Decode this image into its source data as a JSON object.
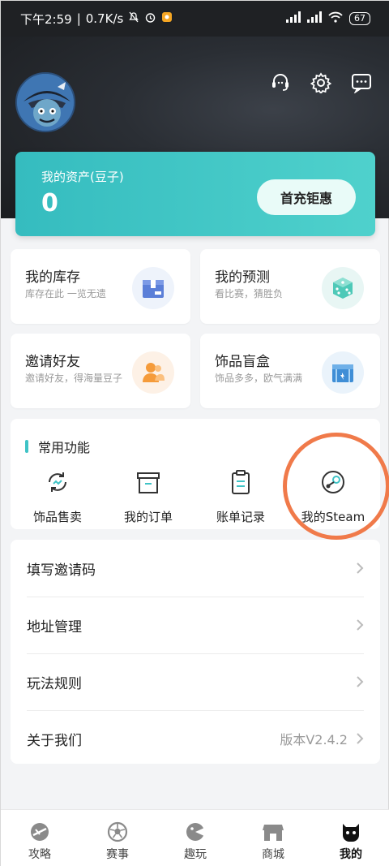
{
  "status_bar": {
    "time": "下午2:59",
    "network_speed": "0.7K/s",
    "battery": "67"
  },
  "header": {
    "icons": [
      "customer-service-icon",
      "gear-icon",
      "message-icon"
    ]
  },
  "asset": {
    "label": "我的资产(豆子)",
    "value": "0",
    "button_label": "首充钜惠"
  },
  "cards": [
    {
      "title": "我的库存",
      "subtitle": "库存在此 一览无遗",
      "icon": "inventory-box-icon"
    },
    {
      "title": "我的预测",
      "subtitle": "看比赛，猜胜负",
      "icon": "dice-icon"
    },
    {
      "title": "邀请好友",
      "subtitle": "邀请好友，得海量豆子",
      "icon": "invite-friends-icon"
    },
    {
      "title": "饰品盲盒",
      "subtitle": "饰品多多，欧气满满",
      "icon": "blind-box-icon"
    }
  ],
  "common": {
    "title": "常用功能",
    "items": [
      {
        "label": "饰品售卖",
        "icon": "trade-icon"
      },
      {
        "label": "我的订单",
        "icon": "order-icon"
      },
      {
        "label": "账单记录",
        "icon": "bill-icon"
      },
      {
        "label": "我的Steam",
        "icon": "steam-icon"
      }
    ]
  },
  "list": [
    {
      "label": "填写邀请码",
      "value": ""
    },
    {
      "label": "地址管理",
      "value": ""
    },
    {
      "label": "玩法规则",
      "value": ""
    },
    {
      "label": "关于我们",
      "value": "版本V2.4.2"
    }
  ],
  "tabs": [
    {
      "label": "攻略",
      "icon": "guide-icon",
      "active": false
    },
    {
      "label": "赛事",
      "icon": "soccer-ball-icon",
      "active": false
    },
    {
      "label": "趣玩",
      "icon": "fun-icon",
      "active": false
    },
    {
      "label": "商城",
      "icon": "shop-icon",
      "active": false
    },
    {
      "label": "我的",
      "icon": "profile-icon",
      "active": true
    }
  ],
  "colors": {
    "accent": "#3fc3c6",
    "highlight_circle": "#f07a4a",
    "header_bg": "#25282c"
  }
}
